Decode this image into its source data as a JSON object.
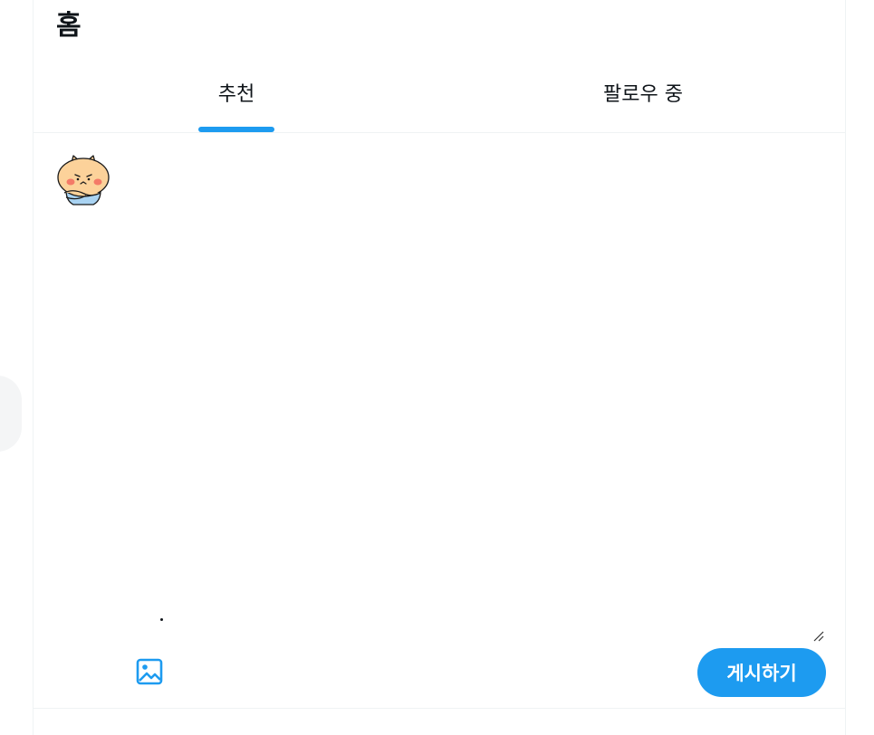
{
  "header": {
    "title": "홈"
  },
  "tabs": [
    {
      "label": "추천",
      "active": true
    },
    {
      "label": "팔로우 중",
      "active": false
    }
  ],
  "composer": {
    "avatar_icon": "cartoon-cat-avatar-icon",
    "media_icon": "image-icon",
    "post_label": "게시하기"
  },
  "colors": {
    "accent": "#1d9bf0",
    "text": "#0f1419",
    "border": "#eff3f4"
  }
}
